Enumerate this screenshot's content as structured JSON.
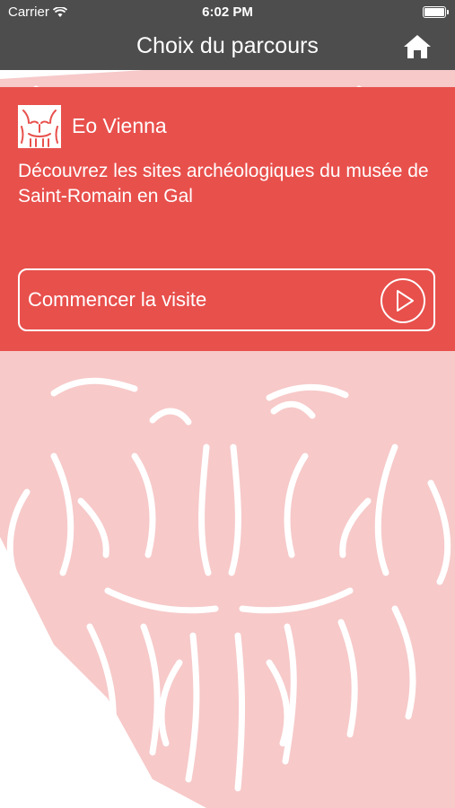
{
  "status_bar": {
    "carrier": "Carrier",
    "time": "6:02 PM",
    "icons": [
      "wifi-icon",
      "battery-icon"
    ]
  },
  "nav": {
    "title": "Choix du parcours",
    "home_icon": "home-icon"
  },
  "card": {
    "name": "Eo Vienna",
    "description": "Découvrez les sites archéologiques du musée de Saint-Romain en Gal",
    "start_label": "Commencer la visite",
    "play_icon": "play-circle-icon",
    "logo_icon": "mask-logo-icon"
  },
  "colors": {
    "bar": "#4d4d4d",
    "accent": "#e8504c",
    "background_art": "#f7cccc"
  }
}
